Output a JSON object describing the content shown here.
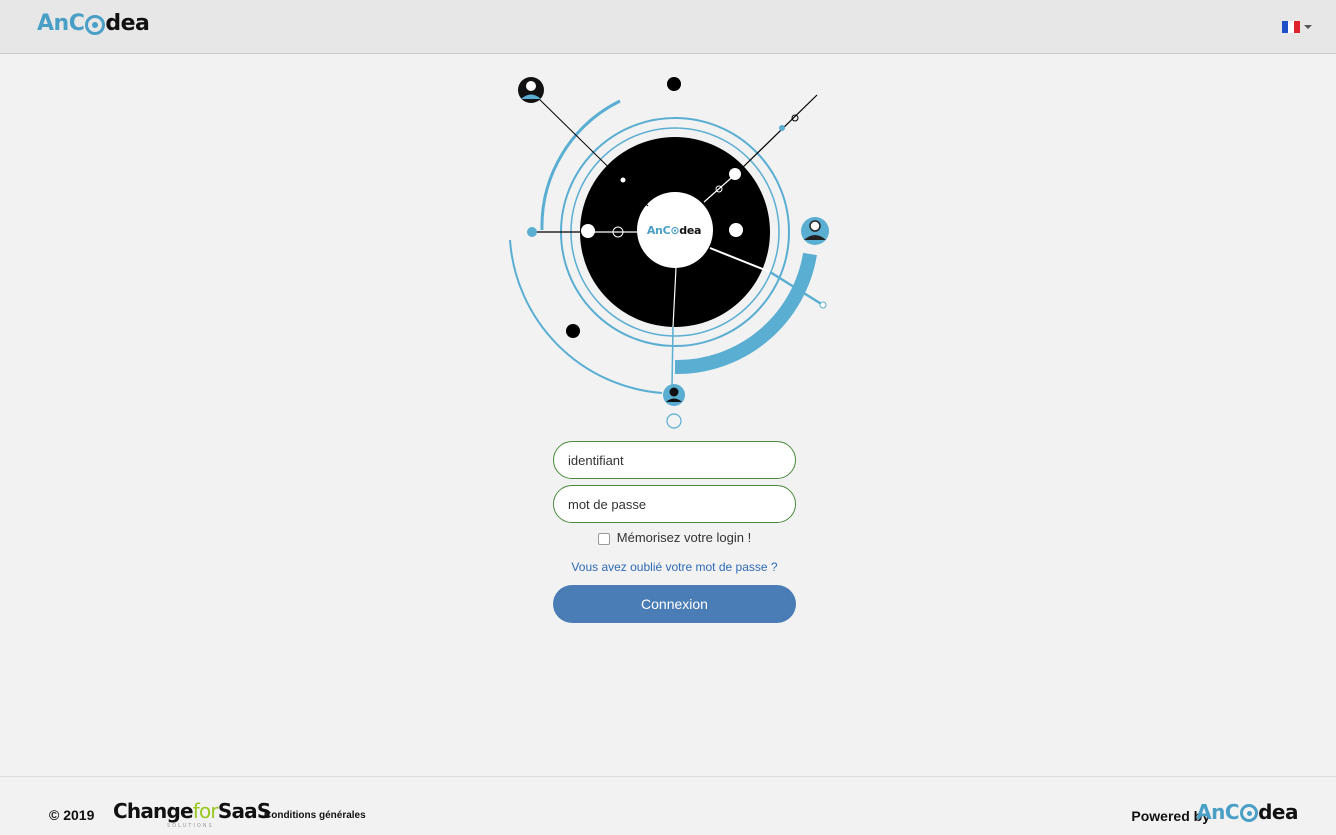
{
  "header": {
    "logo_part1": "AnC",
    "logo_part2": "dea",
    "language_flag_icon": "france-flag-icon",
    "language_caret_icon": "caret-down-icon"
  },
  "illustration": {
    "center_logo_part1": "AnC",
    "center_logo_part2": "dea",
    "avatar_icon": "user-avatar-icon"
  },
  "login_form": {
    "username_placeholder": "identifiant",
    "password_placeholder": "mot de passe",
    "remember_label": "Mémorisez votre login !",
    "forgot_link": "Vous avez oublié votre mot de passe ?",
    "submit_label": "Connexion"
  },
  "footer": {
    "copyright": "© 2019",
    "partner_logo_part1": "Change",
    "partner_logo_part2": "for",
    "partner_logo_part3": "SaaS",
    "partner_logo_sub": "SOLUTIONS",
    "conditions_link": "Conditions générales",
    "powered_by": "Powered by",
    "powered_logo_part1": "AnC",
    "powered_logo_part2": "dea"
  },
  "colors": {
    "brand_blue": "#4a9fc6",
    "button_blue": "#4a7db5",
    "input_border_green": "#4b8a3c",
    "link_blue": "#2f6bb5",
    "partner_green": "#9ac71f"
  }
}
